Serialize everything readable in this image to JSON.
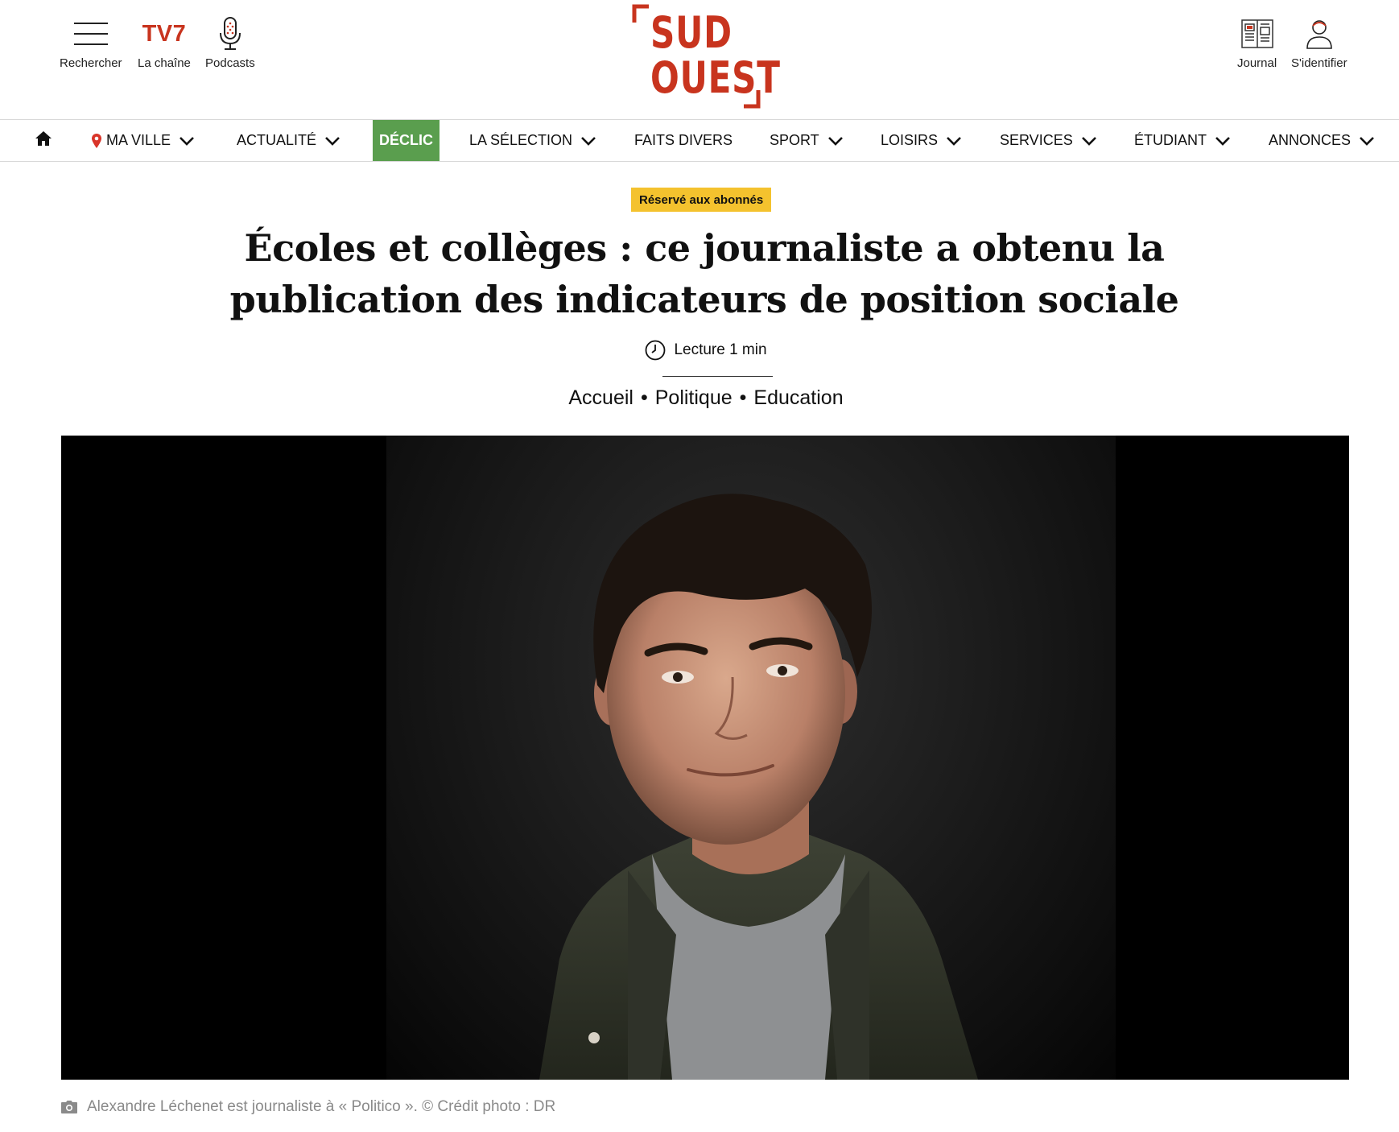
{
  "header": {
    "search_label": "Rechercher",
    "tv7_logo": "TV7",
    "tv_label": "La chaîne",
    "podcasts_label": "Podcasts",
    "journal_label": "Journal",
    "login_label": "S'identifier",
    "logo_line1": "SUD",
    "logo_line2": "OUEST"
  },
  "nav": {
    "items": [
      {
        "label": "MA VILLE",
        "icon": "pin-icon",
        "dropdown": true
      },
      {
        "label": "ACTUALITÉ",
        "dropdown": true
      },
      {
        "label": "DÉCLIC",
        "highlight": "#5a9e4e",
        "dropdown": false
      },
      {
        "label": "LA SÉLECTION",
        "dropdown": true
      },
      {
        "label": "FAITS DIVERS",
        "dropdown": false
      },
      {
        "label": "SPORT",
        "dropdown": true
      },
      {
        "label": "LOISIRS",
        "dropdown": true
      },
      {
        "label": "SERVICES",
        "dropdown": true
      },
      {
        "label": "ÉTUDIANT",
        "dropdown": true
      },
      {
        "label": "ANNONCES",
        "dropdown": true
      }
    ]
  },
  "article": {
    "badge": "Réservé aux abonnés",
    "title": "Écoles et collèges : ce journaliste a obtenu la publication des indicateurs de position sociale",
    "reading_time": "Lecture 1 min",
    "breadcrumb": [
      "Accueil",
      "Politique",
      "Education"
    ],
    "breadcrumb_separator": "•",
    "caption": "Alexandre Léchenet est journaliste à « Politico ». © Crédit photo : DR"
  },
  "colors": {
    "brand_red": "#c8341e",
    "declic_green": "#5a9e4e",
    "badge_yellow": "#f4c22e"
  }
}
